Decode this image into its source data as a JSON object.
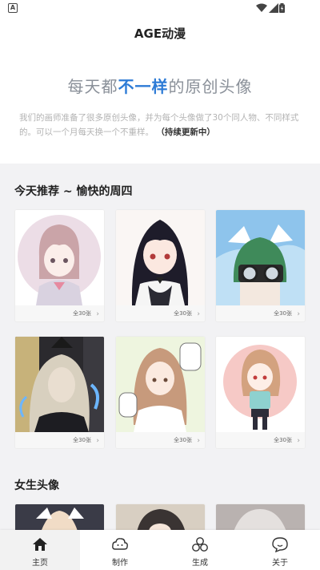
{
  "status_bar": {
    "left_glyph": "A"
  },
  "app": {
    "title": "AGE动漫"
  },
  "hero": {
    "title_before": "每天都",
    "title_highlight": "不一样",
    "title_after": "的原创头像",
    "description": "我们的画师准备了很多原创头像，并为每个头像做了30个同人物、不同样式的。可以一个月每天换一个不重样。",
    "description_strong": "（持续更新中）"
  },
  "sections": [
    {
      "title": "今天推荐 ~ 愉快的周四",
      "cards": [
        {
          "count": "全30张"
        },
        {
          "count": "全30张"
        },
        {
          "count": "全30张"
        },
        {
          "count": "全30张"
        },
        {
          "count": "全30张"
        },
        {
          "count": "全30张"
        }
      ]
    },
    {
      "title": "女生头像"
    }
  ],
  "tabs": [
    {
      "label": "主页",
      "icon": "home-icon",
      "active": true
    },
    {
      "label": "制作",
      "icon": "cloud-face-icon",
      "active": false
    },
    {
      "label": "生成",
      "icon": "three-circles-icon",
      "active": false
    },
    {
      "label": "关于",
      "icon": "chat-bubble-icon",
      "active": false
    }
  ],
  "colors": {
    "accent": "#2d7bd6",
    "background": "#f2f2f4"
  }
}
